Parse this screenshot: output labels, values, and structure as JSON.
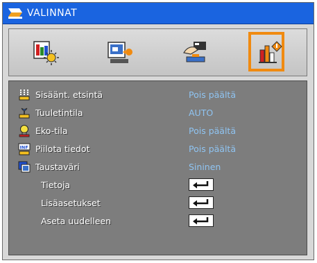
{
  "title": "VALINNAT",
  "colors": {
    "title_bar": "#1a64e0",
    "active_tab_frame": "#f08a10",
    "panel_bg": "#7d7d7d",
    "value_text": "#8fc4f2"
  },
  "tabs": [
    {
      "icon": "image-settings-icon",
      "active": false
    },
    {
      "icon": "display-settings-icon",
      "active": false
    },
    {
      "icon": "setup-hand-icon",
      "active": false
    },
    {
      "icon": "options-chart-icon",
      "active": true
    }
  ],
  "menu": {
    "items": [
      {
        "label": "Sisäänt. etsintä",
        "value": "Pois päältä",
        "icon": "source-lock-icon"
      },
      {
        "label": "Tuuletintila",
        "value": "AUTO",
        "icon": "fan-mode-icon"
      },
      {
        "label": "Eko-tila",
        "value": "Pois päältä",
        "icon": "eco-lamp-icon"
      },
      {
        "label": "Piilota tiedot",
        "value": "Pois päältä",
        "icon": "hide-info-icon"
      },
      {
        "label": "Taustaväri",
        "value": "Sininen",
        "icon": "background-color-icon"
      },
      {
        "label": "Tietoja",
        "action": "enter-icon"
      },
      {
        "label": "Lisäasetukset",
        "action": "enter-icon"
      },
      {
        "label": "Aseta uudelleen",
        "action": "enter-icon"
      }
    ]
  }
}
